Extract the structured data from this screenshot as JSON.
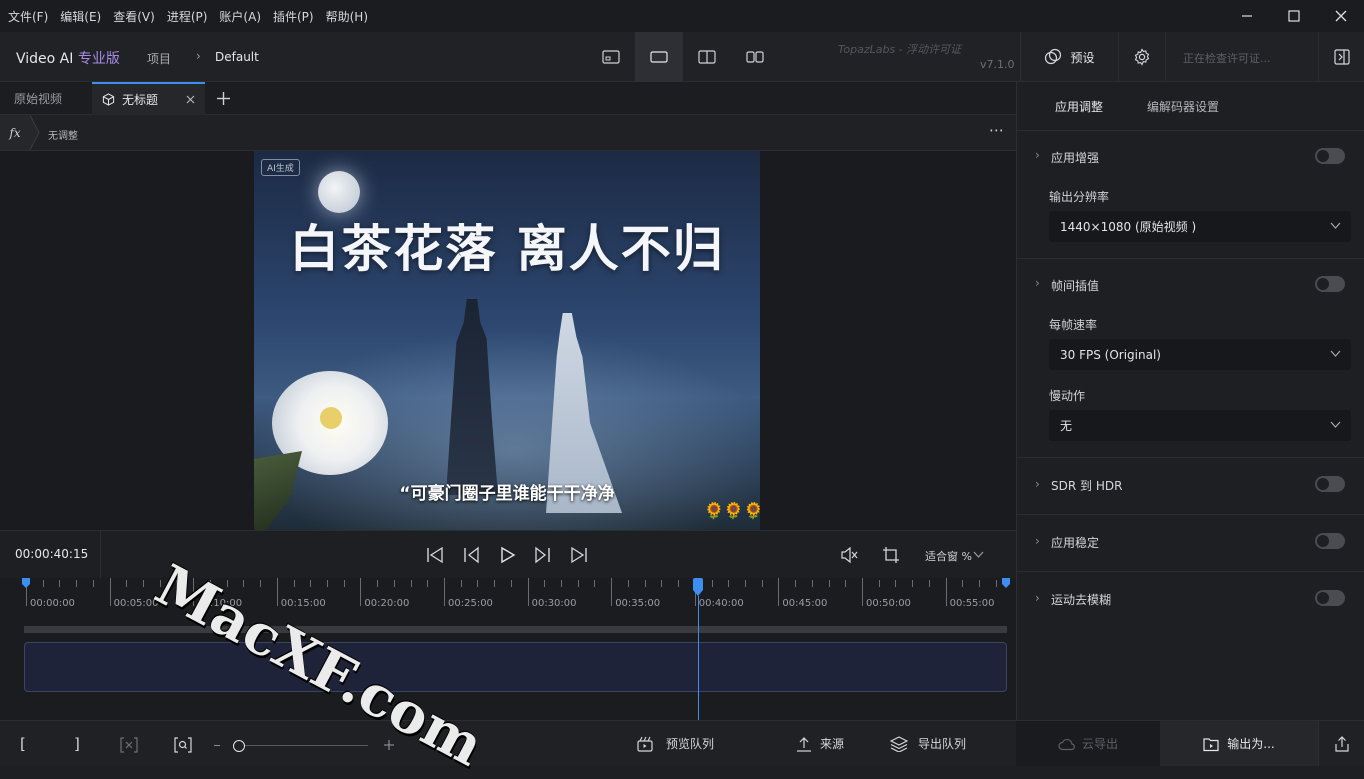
{
  "menu": [
    "文件(F)",
    "编辑(E)",
    "查看(V)",
    "进程(P)",
    "账户(A)",
    "插件(P)",
    "帮助(H)"
  ],
  "header": {
    "app_name": "Video AI",
    "app_edition": "专业版",
    "breadcrumb_project": "项目",
    "breadcrumb_current": "Default",
    "license_text": "TopazLabs - 浮动许可证",
    "version": "v7.1.0",
    "presets_label": "预设",
    "license_check": "正在检查许可证..."
  },
  "tabs": {
    "original": "原始视频",
    "active": "无标题"
  },
  "fx": {
    "icon_text": "fx",
    "label": "无调整"
  },
  "video": {
    "badge": "AI生成",
    "title": "白茶花落 离人不归",
    "subtitle": "“可豪门圈子里谁能干干净净",
    "emoji": "🌻🌻🌻"
  },
  "controls": {
    "timecode": "00:00:40:15",
    "zoom_label": "适合窗 %"
  },
  "timeline": {
    "ticks": [
      "00:00:00",
      "00:05:00",
      "00:10:00",
      "00:15:00",
      "00:20:00",
      "00:25:00",
      "00:30:00",
      "00:35:00",
      "00:40:00",
      "00:45:00",
      "00:50:00",
      "00:55:00"
    ],
    "playhead_fraction": 0.686
  },
  "panel": {
    "tab_apply": "应用调整",
    "tab_codec": "编解码器设置",
    "enhance": "应用增强",
    "output_res_label": "输出分辨率",
    "output_res_value": "1440×1080 (原始视频   )",
    "frame_interp": "帧间插值",
    "fps_label": "每帧速率",
    "fps_value": "30 FPS (Original)",
    "slowmo_label": "慢动作",
    "slowmo_value": "无",
    "sdr_hdr": "SDR 到 HDR",
    "stabilize": "应用稳定",
    "deblur": "运动去模糊"
  },
  "bottom": {
    "preview_queue": "预览队列",
    "source": "来源",
    "export_queue": "导出队列",
    "cloud_export": "云导出",
    "export_as": "输出为..."
  },
  "watermark": "MacXF.com",
  "colors": {
    "accent": "#3d8ef0",
    "edition": "#a98ae8"
  }
}
